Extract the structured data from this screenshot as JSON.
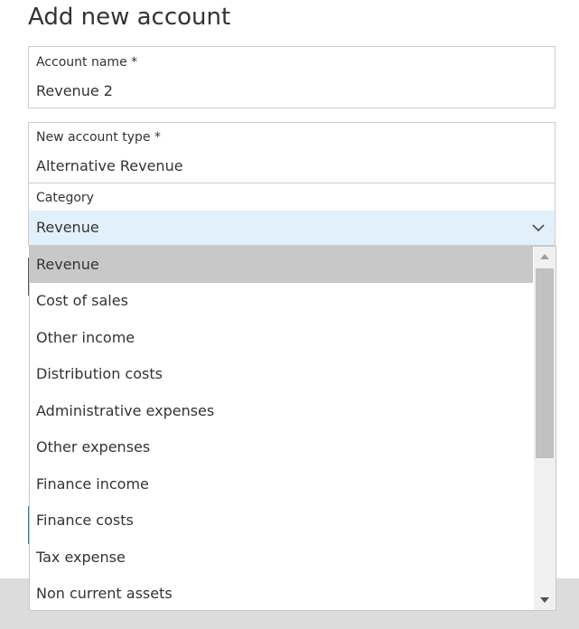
{
  "page": {
    "title": "Add new account"
  },
  "form": {
    "account_name": {
      "label": "Account name *",
      "value": "Revenue 2"
    },
    "account_type": {
      "label": "New account type *",
      "value": "Alternative Revenue"
    },
    "category": {
      "label": "Category",
      "value": "Revenue"
    }
  },
  "dropdown": {
    "selected_index": 0,
    "options": [
      "Revenue",
      "Cost of sales",
      "Other income",
      "Distribution costs",
      "Administrative expenses",
      "Other expenses",
      "Finance income",
      "Finance costs",
      "Tax expense",
      "Non current assets"
    ]
  },
  "colors": {
    "select_highlight": "#e1f0fa",
    "selected_option": "#c8c8c8",
    "scroll_thumb": "#c1c1c1"
  },
  "icons": {
    "category_chevron": "chevron-down-icon",
    "scroll_up": "triangle-up-icon",
    "scroll_down": "triangle-down-icon"
  }
}
